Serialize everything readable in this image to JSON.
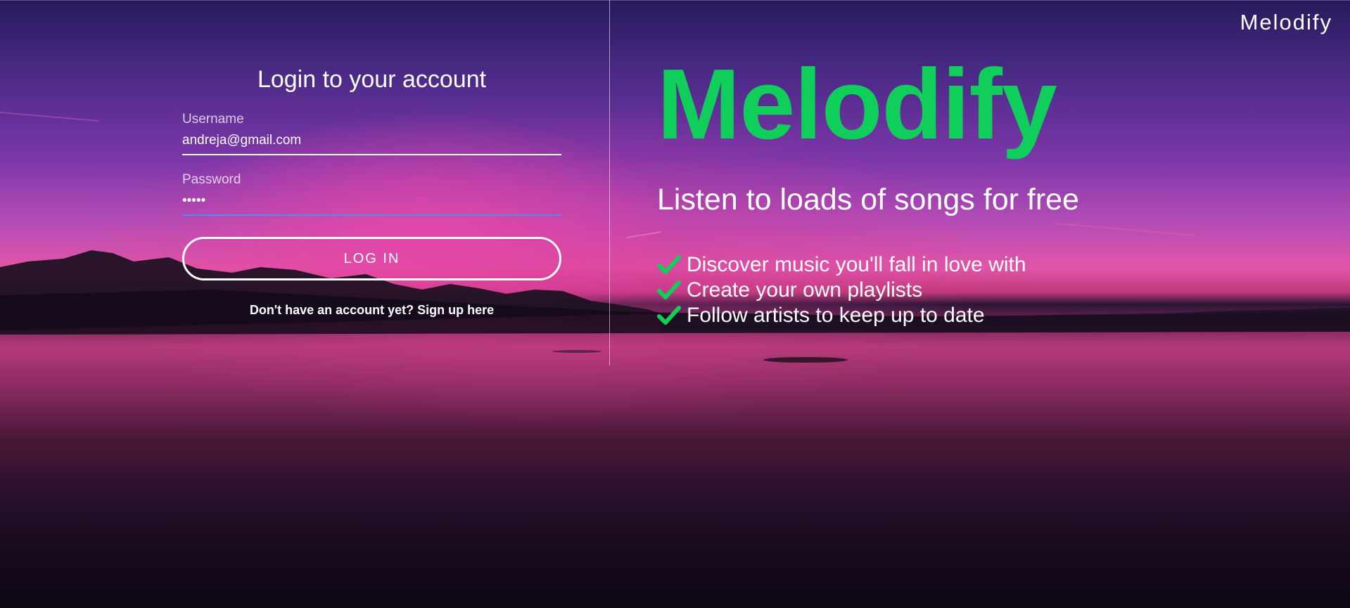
{
  "header": {
    "brand": "Melodify"
  },
  "login": {
    "title": "Login to your account",
    "username_label": "Username",
    "username_value": "andreja@gmail.com",
    "password_label": "Password",
    "password_value": "•••••",
    "login_button": "LOG IN",
    "signup_link": "Don't have an account yet? Sign up here"
  },
  "hero": {
    "title": "Melodify",
    "subtitle": "Listen to loads of songs for free",
    "features": [
      "Discover music you'll fall in love with",
      "Create your own playlists",
      "Follow artists to keep up to date"
    ]
  },
  "colors": {
    "brand_green": "#0fcf5a",
    "focus_blue": "#4f8fe8"
  },
  "icons": {
    "feature_icon": "check-icon"
  }
}
